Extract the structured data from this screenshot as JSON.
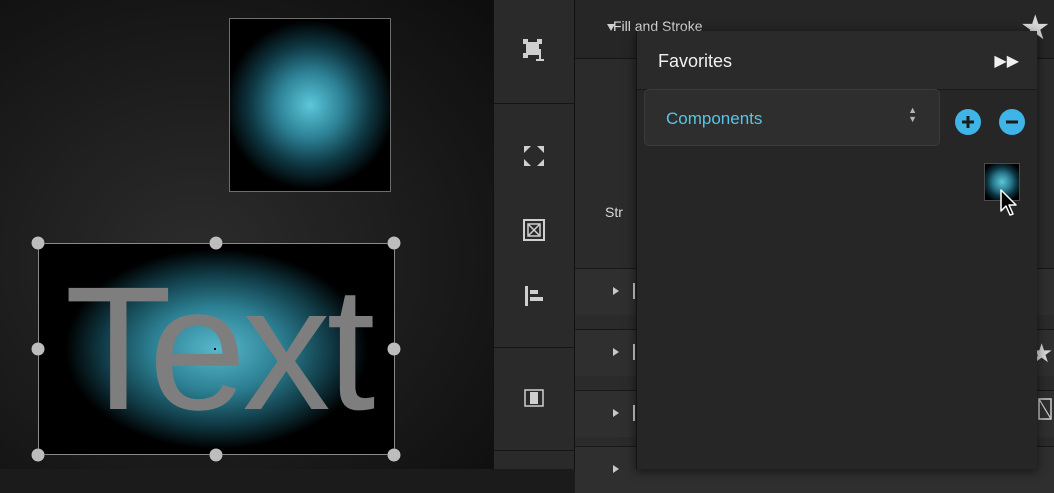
{
  "canvas": {
    "text_object": "Text"
  },
  "inspector": {
    "section_title": "Fill and Stroke",
    "stroke_label": "Str"
  },
  "favorites": {
    "title": "Favorites",
    "collapse_glyph": "▶▶",
    "category": "Components",
    "category_arrows": "▲▼",
    "item_count": 1
  },
  "colors": {
    "accent": "#55c6e6",
    "button_blue": "#3fb4e6",
    "glow": "#5cc7db"
  },
  "icons": [
    "resize-icon",
    "fit-to-window-icon",
    "frame-icon",
    "align-left-icon",
    "page-icon",
    "add-icon",
    "remove-icon",
    "star-icon",
    "pointer-cursor-icon"
  ]
}
